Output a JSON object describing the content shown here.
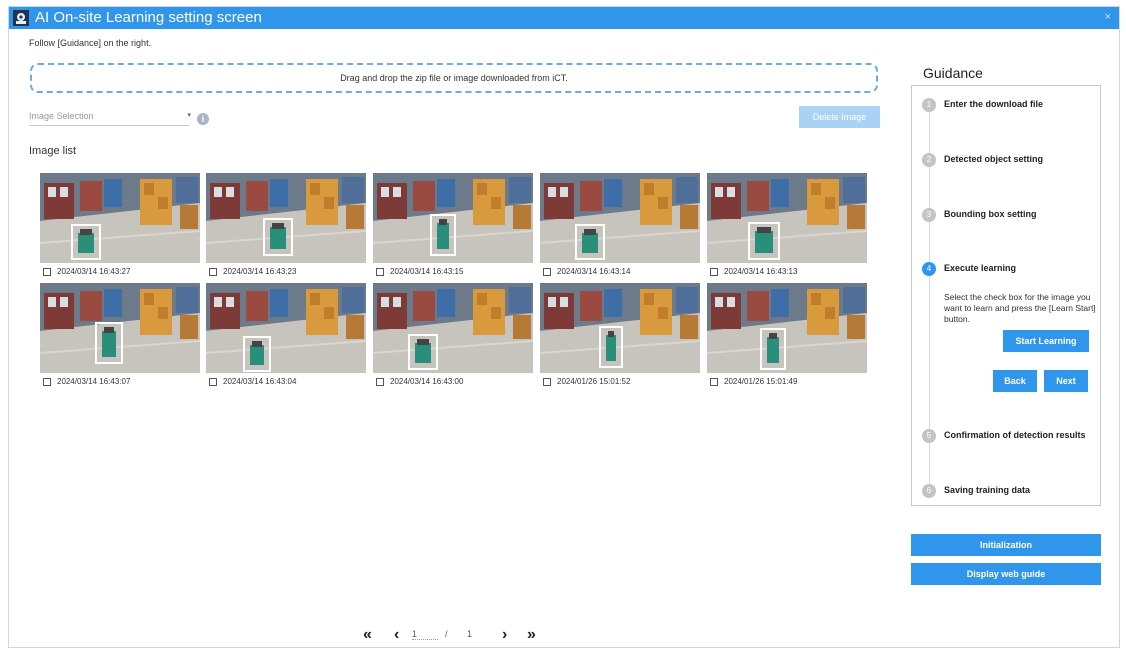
{
  "window": {
    "title": "AI On-site Learning setting screen",
    "close": "×"
  },
  "instruction": "Follow [Guidance] on the right.",
  "dropzone": "Drag and drop the zip file or image downloaded from iCT.",
  "image_selection": {
    "placeholder": "Image Selection",
    "arrow": "▾",
    "info": "i"
  },
  "delete_button": "Delete Image",
  "image_list_label": "Image list",
  "images": [
    {
      "timestamp": "2024/03/14 16:43:27"
    },
    {
      "timestamp": "2024/03/14 16:43:23"
    },
    {
      "timestamp": "2024/03/14 16:43:15"
    },
    {
      "timestamp": "2024/03/14 16:43:14"
    },
    {
      "timestamp": "2024/03/14 16:43:13"
    },
    {
      "timestamp": "2024/03/14 16:43:07"
    },
    {
      "timestamp": "2024/03/14 16:43:04"
    },
    {
      "timestamp": "2024/03/14 16:43:00"
    },
    {
      "timestamp": "2024/01/26 15:01:52"
    },
    {
      "timestamp": "2024/01/26 15:01:49"
    }
  ],
  "pagination": {
    "first": "«",
    "prev": "‹",
    "current": "1",
    "separator": "/",
    "total": "1",
    "next": "›",
    "last": "»"
  },
  "guidance": {
    "title": "Guidance",
    "steps": [
      {
        "number": "1",
        "label": "Enter the download file",
        "active": false
      },
      {
        "number": "2",
        "label": "Detected object setting",
        "active": false
      },
      {
        "number": "3",
        "label": "Bounding box setting",
        "active": false
      },
      {
        "number": "4",
        "label": "Execute learning",
        "active": true
      },
      {
        "number": "5",
        "label": "Confirmation of detection results",
        "active": false
      },
      {
        "number": "6",
        "label": "Saving training data",
        "active": false
      }
    ],
    "active_description": "Select the check box for the image you want to learn and press the [Learn Start] button.",
    "start_learning": "Start Learning",
    "back": "Back",
    "next": "Next"
  },
  "initialization_button": "Initialization",
  "web_guide_button": "Display web guide",
  "colors": {
    "accent": "#2f96ec",
    "disabled": "#a9d2f5"
  }
}
